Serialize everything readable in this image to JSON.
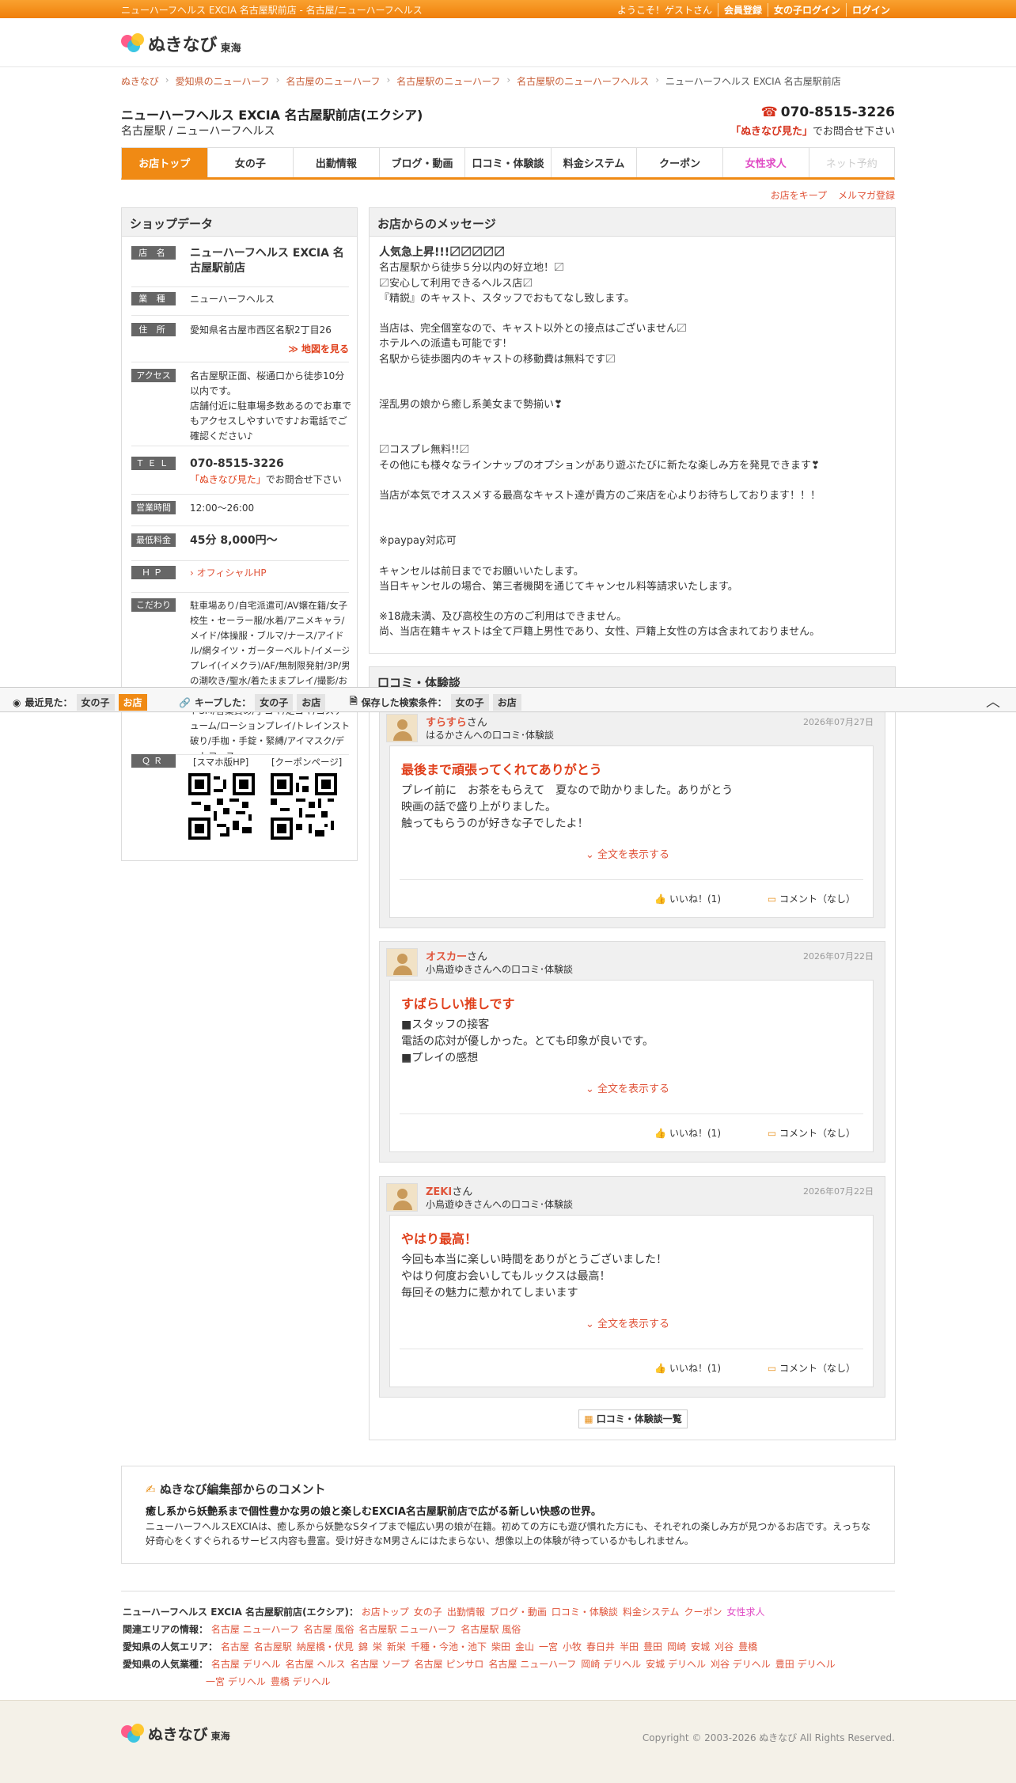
{
  "topbar": {
    "title": "ニューハーフヘルス EXCIA 名古屋駅前店 - 名古屋/ニューハーフヘルス",
    "welcome": "ようこそ！ゲストさん",
    "register": "会員登録",
    "girl_login": "女の子ログイン",
    "login": "ログイン"
  },
  "logo": {
    "text": "ぬきなび",
    "region": "東海"
  },
  "breadcrumb": [
    "ぬきなび",
    "愛知県のニューハーフ",
    "名古屋のニューハーフ",
    "名古屋駅のニューハーフ",
    "名古屋駅のニューハーフヘルス",
    "ニューハーフヘルス EXCIA 名古屋駅前店"
  ],
  "shop": {
    "title": "ニューハーフヘルス EXCIA 名古屋駅前店(エクシア)",
    "subtitle": "名古屋駅 / ニューハーフヘルス",
    "phone": "070-8515-3226",
    "phone_note_em": "「ぬきなび見た」",
    "phone_note": "でお問合せ下さい"
  },
  "tabs": [
    "お店トップ",
    "女の子",
    "出勤情報",
    "ブログ・動画",
    "口コミ・体験談",
    "料金システム",
    "クーポン",
    "女性求人",
    "ネット予約"
  ],
  "keep_links": [
    "お店をキープ",
    "メルマガ登録"
  ],
  "shopdata": {
    "heading": "ショップデータ",
    "name_label": "店 名",
    "name": "ニューハーフヘルス EXCIA 名古屋駅前店",
    "type_label": "業 種",
    "type": "ニューハーフヘルス",
    "addr_label": "住 所",
    "addr": "愛知県名古屋市西区名駅2丁目26",
    "map_link": "≫ 地図を見る",
    "access_label": "アクセス",
    "access": "名古屋駅正面、桜通口から徒歩10分以内です。\n店舗付近に駐車場多数あるのでお車でもアクセスしやすいです♪お電話でご確認ください♪",
    "tel_label": "ＴＥＬ",
    "tel": "070-8515-3226",
    "tel_em": "「ぬきなび見た」",
    "tel_note": "でお問合せ下さい",
    "hours_label": "営業時間",
    "hours": "12:00〜26:00",
    "price_label": "最低料金",
    "price": "45分 8,000円〜",
    "hp_label": "ＨＰ",
    "hp": "オフィシャルHP",
    "kodawari_label": "こだわり",
    "kodawari": "駐車場あり/自宅派遣可/AV嬢在籍/女子校生・セーラー服/水着/アニメキャラ/メイド/体操服・ブルマ/ナース/アイドル/網タイツ・ガーターベルト/イメージプレイ(イメクラ)/AF/無制限発射/3P/男の潮吹き/聖水/着たままプレイ/撮影/お泊まり延長可/エステ/アナル舐め/ソフトSM/言葉責め/手コキ/足コキ/コスチューム/ローションプレイ/トレインスト破り/手枷・手錠・緊縛/アイマスク/デートコース",
    "qr_label": "ＱＲ",
    "qr_sp": "[スマホ版HP]",
    "qr_coupon": "[クーポンページ]"
  },
  "message": {
    "heading": "お店からのメッセージ",
    "lines": [
      "人気急上昇!!!〼〼〼〼〼",
      "名古屋駅から徒歩５分以内の好立地！〼",
      "〼安心して利用できるヘルス店〼",
      "『精鋭』のキャスト、スタッフでおもてなし致します。",
      "",
      "当店は、完全個室なので、キャスト以外との接点はございません〼",
      "ホテルへの派遣も可能です!",
      "名駅から徒歩圏内のキャストの移動費は無料です〼",
      "",
      "",
      "淫乱男の娘から癒し系美女まで勢揃い❣",
      "",
      "",
      "〼コスプレ無料!!〼",
      "その他にも様々なラインナップのオプションがあり遊ぶたびに新たな楽しみ方を発見できます❣",
      "",
      "当店が本気でオススメする最高なキャスト達が貴方のご来店を心よりお待ちしております！！！",
      "",
      "",
      "※paypay対応可",
      "",
      "キャンセルは前日まででお願いいたします。",
      "当日キャンセルの場合、第三者機関を通じてキャンセル料等請求いたします。",
      "",
      "※18歳未満、及び高校生の方のご利用はできません。",
      "尚、当店在籍キャストは全て戸籍上男性であり、女性、戸籍上女性の方は含まれておりません。"
    ]
  },
  "reviews": {
    "heading": "口コミ・体験談",
    "items": [
      {
        "name": "すらすら",
        "san": "さん",
        "to": "はるかさんへの口コミ･体験談",
        "date": "2026年07月27日",
        "title": "最後まで頑張ってくれてありがとう",
        "text": "プレイ前に　お茶をもらえて　夏なので助かりました。ありがとう\n映画の話で盛り上がりました。\n触ってもらうのが好きな子でしたよ！",
        "more": "全文を表示する",
        "like": "いいね！(1)",
        "comment": "コメント（なし）"
      },
      {
        "name": "オスカー",
        "san": "さん",
        "to": "小鳥遊ゆきさんへの口コミ･体験談",
        "date": "2026年07月22日",
        "title": "すばらしい推しです",
        "text": "■スタッフの接客\n電話の応対が優しかった。とても印象が良いです。\n■プレイの感想",
        "more": "全文を表示する",
        "like": "いいね！(1)",
        "comment": "コメント（なし）"
      },
      {
        "name": "ZEKI",
        "san": "さん",
        "to": "小鳥遊ゆきさんへの口コミ･体験談",
        "date": "2026年07月22日",
        "title": "やはり最高！",
        "text": "今回も本当に楽しい時間をありがとうございました！\nやはり何度お会いしてもルックスは最高！\n毎回その魅力に惹かれてしまいます",
        "more": "全文を表示する",
        "like": "いいね！(1)",
        "comment": "コメント（なし）"
      }
    ],
    "list_button": "口コミ・体験談一覧"
  },
  "bottom_bar": {
    "recent": "最近見た：",
    "recent_girl": "女の子",
    "recent_shop": "お店",
    "kept": "キープした：",
    "kept_girl": "女の子",
    "kept_shop": "お店",
    "saved": "保存した検索条件：",
    "saved_girl": "女の子",
    "saved_shop": "お店"
  },
  "editor": {
    "heading": "ぬきなび編集部からのコメント",
    "title": "癒し系から妖艶系まで個性豊かな男の娘と楽しむEXCIA名古屋駅前店で広がる新しい快感の世界。",
    "body": "ニューハーフヘルスEXCIAは、癒し系から妖艶なSタイプまで幅広い男の娘が在籍。初めての方にも遊び慣れた方にも、それぞれの楽しみ方が見つかるお店です。えっちな好奇心をくすぐられるサービス内容も豊富。受け好きなM男さんにはたまらない、想像以上の体験が待っているかもしれません。"
  },
  "footer_links": {
    "shop_label": "ニューハーフヘルス EXCIA 名古屋駅前店(エクシア)：",
    "shop_links": [
      "お店トップ",
      "女の子",
      "出勤情報",
      "ブログ・動画",
      "口コミ・体験談",
      "料金システム",
      "クーポン",
      "女性求人"
    ],
    "area_label": "関連エリアの情報：",
    "area_links": [
      "名古屋 ニューハーフ",
      "名古屋 風俗",
      "名古屋駅 ニューハーフ",
      "名古屋駅 風俗"
    ],
    "popular_area_label": "愛知県の人気エリア：",
    "popular_area_links": [
      "名古屋",
      "名古屋駅",
      "納屋橋・伏見",
      "錦",
      "栄",
      "新栄",
      "千種・今池・池下",
      "柴田",
      "金山",
      "一宮",
      "小牧",
      "春日井",
      "半田",
      "豊田",
      "岡崎",
      "安城",
      "刈谷",
      "豊橋"
    ],
    "popular_type_label": "愛知県の人気業種：",
    "popular_type_links": [
      "名古屋 デリヘル",
      "名古屋 ヘルス",
      "名古屋 ソープ",
      "名古屋 ピンサロ",
      "名古屋 ニューハーフ",
      "岡崎 デリヘル",
      "安城 デリヘル",
      "刈谷 デリヘル",
      "豊田 デリヘル",
      "一宮 デリヘル",
      "豊橋 デリヘル"
    ]
  },
  "copyright": "Copyright © 2003-2026 ぬきなび All Rights Reserved."
}
